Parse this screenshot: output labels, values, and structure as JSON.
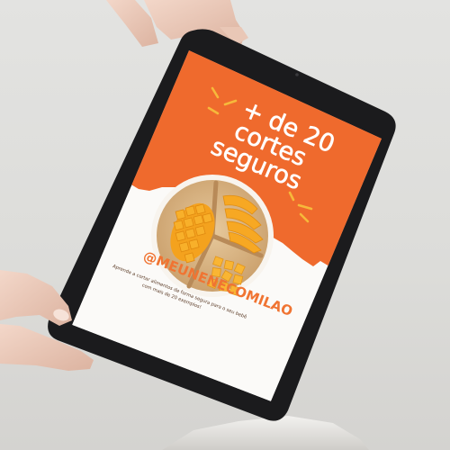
{
  "ebook": {
    "title_lines": [
      "+ de 20",
      "cortes",
      "seguros"
    ],
    "handle": "@MEUNENECOMILAO",
    "caption_lines": [
      "Aprenda a cortar alimentos de forma segura para o seu bebê",
      "com mais de 20 exemplos!"
    ]
  },
  "colors": {
    "background": "#dedddb",
    "tablet_frame": "#1b1b1d",
    "cover_orange": "#ef6a2d",
    "cover_white": "#fbfaf8",
    "accent_orange": "#f07432",
    "sparkle_yellow": "#f6b93b"
  },
  "icons": [
    "sparkle-icon",
    "sparkle-icon"
  ]
}
